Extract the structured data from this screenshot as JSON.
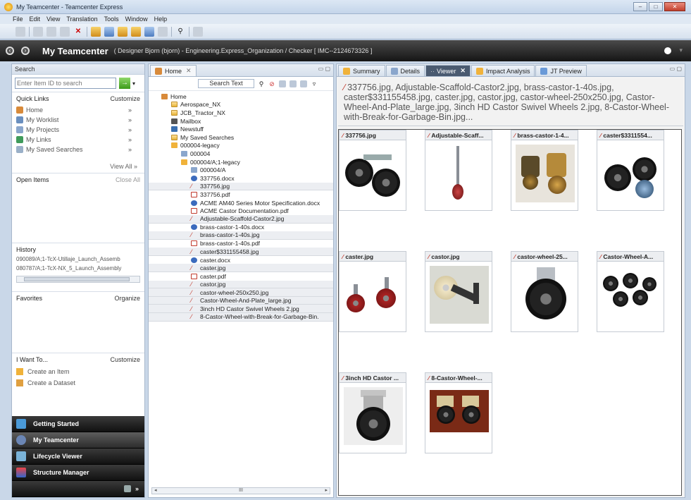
{
  "window": {
    "title": "My Teamcenter - Teamcenter Express",
    "controls": [
      "–",
      "□",
      "✕"
    ]
  },
  "menu": [
    "File",
    "Edit",
    "View",
    "Translation",
    "Tools",
    "Window",
    "Help"
  ],
  "header": {
    "title": "My Teamcenter",
    "subtitle": "( Designer Bjorn (bjorn) - Engineering.Express_Organization / Checker  [ IMC--2124673326 ]"
  },
  "search": {
    "section": "Search",
    "placeholder": "Enter Item ID to search",
    "go": "→"
  },
  "quick_links": {
    "title": "Quick Links",
    "action": "Customize",
    "items": [
      {
        "label": "Home",
        "arrow": "»"
      },
      {
        "label": "My Worklist",
        "arrow": "»"
      },
      {
        "label": "My Projects",
        "arrow": "»"
      },
      {
        "label": "My Links",
        "arrow": "»"
      },
      {
        "label": "My Saved Searches",
        "arrow": "»"
      }
    ],
    "view_all": "View All  »"
  },
  "open_items": {
    "title": "Open Items",
    "action": "Close All"
  },
  "history": {
    "title": "History",
    "items": [
      "090089/A;1-TcX-Utillaje_Launch_Assemb",
      "080787/A;1-TcX-NX_5_Launch_Assembly"
    ]
  },
  "favorites": {
    "title": "Favorites",
    "action": "Organize"
  },
  "i_want_to": {
    "title": "I Want To...",
    "action": "Customize",
    "items": [
      "Create an Item",
      "Create a Dataset"
    ]
  },
  "apps": [
    "Getting Started",
    "My Teamcenter",
    "Lifecycle Viewer",
    "Structure Manager"
  ],
  "home_panel": {
    "tab": "Home",
    "search_text": "Search Text",
    "tree": [
      {
        "label": "Home",
        "icon": "home",
        "indent": 0,
        "shaded": false
      },
      {
        "label": "Aerospace_NX",
        "icon": "folder",
        "indent": 1,
        "shaded": false
      },
      {
        "label": "JCB_Tractor_NX",
        "icon": "folder",
        "indent": 1,
        "shaded": false
      },
      {
        "label": "Mailbox",
        "icon": "mail",
        "indent": 1,
        "shaded": false
      },
      {
        "label": "Newstuff",
        "icon": "news",
        "indent": 1,
        "shaded": false
      },
      {
        "label": "My Saved Searches",
        "icon": "folder",
        "indent": 1,
        "shaded": false
      },
      {
        "label": "000004-legacy",
        "icon": "item",
        "indent": 1,
        "shaded": false
      },
      {
        "label": "000004",
        "icon": "rev",
        "indent": 2,
        "shaded": false
      },
      {
        "label": "000004/A;1-legacy",
        "icon": "item",
        "indent": 2,
        "shaded": false
      },
      {
        "label": "000004/A",
        "icon": "rev",
        "indent": 3,
        "shaded": false
      },
      {
        "label": "337756.docx",
        "icon": "docx",
        "indent": 3,
        "shaded": false
      },
      {
        "label": "337756.jpg",
        "icon": "jpg",
        "indent": 3,
        "shaded": true
      },
      {
        "label": "337756.pdf",
        "icon": "pdf",
        "indent": 3,
        "shaded": false
      },
      {
        "label": "ACME AM40 Series Motor Specification.docx",
        "icon": "docx",
        "indent": 3,
        "shaded": false
      },
      {
        "label": "ACME Castor Documentation.pdf",
        "icon": "pdf",
        "indent": 3,
        "shaded": false
      },
      {
        "label": "Adjustable-Scaffold-Castor2.jpg",
        "icon": "jpg",
        "indent": 3,
        "shaded": true
      },
      {
        "label": "brass-castor-1-40s.docx",
        "icon": "docx",
        "indent": 3,
        "shaded": false
      },
      {
        "label": "brass-castor-1-40s.jpg",
        "icon": "jpg",
        "indent": 3,
        "shaded": true
      },
      {
        "label": "brass-castor-1-40s.pdf",
        "icon": "pdf",
        "indent": 3,
        "shaded": false
      },
      {
        "label": "caster$331155458.jpg",
        "icon": "jpg",
        "indent": 3,
        "shaded": true
      },
      {
        "label": "caster.docx",
        "icon": "docx",
        "indent": 3,
        "shaded": false
      },
      {
        "label": "caster.jpg",
        "icon": "jpg",
        "indent": 3,
        "shaded": true
      },
      {
        "label": "caster.pdf",
        "icon": "pdf",
        "indent": 3,
        "shaded": false
      },
      {
        "label": "castor.jpg",
        "icon": "jpg",
        "indent": 3,
        "shaded": true
      },
      {
        "label": "castor-wheel-250x250.jpg",
        "icon": "jpg",
        "indent": 3,
        "shaded": true
      },
      {
        "label": "Castor-Wheel-And-Plate_large.jpg",
        "icon": "jpg",
        "indent": 3,
        "shaded": true
      },
      {
        "label": "3inch HD Castor Swivel Wheels 2.jpg",
        "icon": "jpg",
        "indent": 3,
        "shaded": true
      },
      {
        "label": "8-Castor-Wheel-with-Break-for-Garbage-Bin.",
        "icon": "jpg",
        "indent": 3,
        "shaded": true
      }
    ],
    "scroll_left": "◂",
    "scroll_mid": "III",
    "scroll_right": "▸"
  },
  "viewer_tabs": [
    {
      "label": "Summary",
      "active": false
    },
    {
      "label": "Details",
      "active": false
    },
    {
      "label": "Viewer",
      "active": true
    },
    {
      "label": "Impact Analysis",
      "active": false
    },
    {
      "label": "JT Preview",
      "active": false
    }
  ],
  "selection_text": "337756.jpg, Adjustable-Scaffold-Castor2.jpg, brass-castor-1-40s.jpg, caster$331155458.jpg, caster.jpg, castor.jpg, castor-wheel-250x250.jpg, Castor-Wheel-And-Plate_large.jpg, 3inch HD Castor Swivel Wheels 2.jpg, 8-Castor-Wheel-with-Break-for-Garbage-Bin.jpg...",
  "thumbnails": [
    "337756.jpg",
    "Adjustable-Scaff...",
    "brass-castor-1-4...",
    "caster$3311554...",
    "caster.jpg",
    "castor.jpg",
    "castor-wheel-25...",
    "Castor-Wheel-A...",
    "3inch HD Castor ...",
    "8-Castor-Wheel-..."
  ]
}
